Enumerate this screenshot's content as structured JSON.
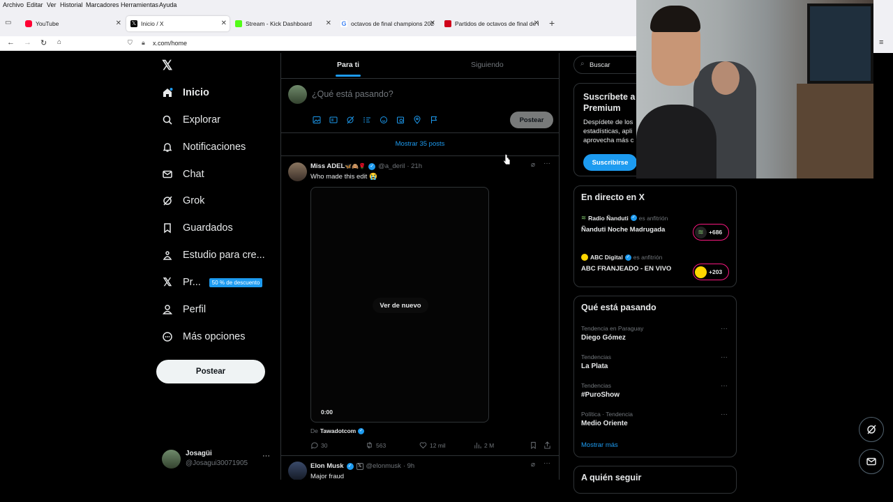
{
  "browser": {
    "menu": [
      "Archivo",
      "Editar",
      "Ver",
      "Historial",
      "Marcadores",
      "Herramientas",
      "Ayuda"
    ],
    "tabs": [
      {
        "title": "YouTube",
        "color": "#ff0033"
      },
      {
        "title": "Inicio / X",
        "color": "#000000"
      },
      {
        "title": "Stream - Kick Dashboard",
        "color": "#53fc18"
      },
      {
        "title": "octavos de final champions 202",
        "color": "#4285f4"
      },
      {
        "title": "Partidos de octavos de final de l",
        "color": "#d0021b"
      }
    ],
    "new_tab": "+",
    "url": "x.com/home"
  },
  "sidebar": {
    "items": [
      {
        "label": "Inicio",
        "icon": "home-icon"
      },
      {
        "label": "Explorar",
        "icon": "search-icon"
      },
      {
        "label": "Notificaciones",
        "icon": "bell-icon"
      },
      {
        "label": "Chat",
        "icon": "mail-icon"
      },
      {
        "label": "Grok",
        "icon": "grok-icon"
      },
      {
        "label": "Guardados",
        "icon": "bookmark-icon"
      },
      {
        "label": "Estudio para cre...",
        "icon": "creator-studio-icon"
      },
      {
        "label": "Pr...",
        "icon": "x-premium-icon",
        "badge": "50 % de descuento"
      },
      {
        "label": "Perfil",
        "icon": "person-icon"
      },
      {
        "label": "Más opciones",
        "icon": "more-icon"
      }
    ],
    "post_button": "Postear",
    "account": {
      "name": "Josagüi",
      "handle": "@Josagui30071905",
      "more": "···"
    }
  },
  "feed": {
    "tabs": [
      "Para ti",
      "Siguiendo"
    ],
    "compose_placeholder": "¿Qué está pasando?",
    "compose_post": "Postear",
    "show_more": "Mostrar 35 posts",
    "tweets": [
      {
        "name": "Miss ADEL",
        "name_emoji": "🦋🙈🌹",
        "handle": "@a_deril",
        "time": "· 21h",
        "text": "Who made this edit 😭",
        "video_replay": "Ver de nuevo",
        "video_time": "0:00",
        "source_prefix": "De",
        "source": "Tawadotcom",
        "replies": "30",
        "reposts": "563",
        "likes": "12 mil",
        "views": "2 M"
      },
      {
        "name": "Elon Musk",
        "handle": "@elonmusk",
        "time": "· 9h",
        "text": "Major fraud"
      }
    ]
  },
  "right": {
    "search_placeholder": "Buscar",
    "premium": {
      "title_line1": "Suscríbete a",
      "title_line2": "Premium",
      "body_line1": "Despídete de los",
      "body_line2": "estadísticas, apli",
      "body_line3": "aprovecha más c",
      "button": "Suscribirse"
    },
    "live": {
      "title": "En directo en X",
      "items": [
        {
          "host": "Radio Ñanduti",
          "role": "es anfitrión",
          "title": "Ñanduti Noche Madrugada",
          "count": "+686"
        },
        {
          "host": "ABC Digital",
          "role": "es anfitrión",
          "title": "ABC FRANJEADO - EN VIVO",
          "count": "+203"
        }
      ]
    },
    "trends": {
      "title": "Qué está pasando",
      "items": [
        {
          "category": "Tendencia en Paraguay",
          "name": "Diego Gómez"
        },
        {
          "category": "Tendencias",
          "name": "La Plata"
        },
        {
          "category": "Tendencias",
          "name": "#PuroShow"
        },
        {
          "category": "Política · Tendencia",
          "name": "Medio Oriente"
        }
      ],
      "show_more": "Mostrar más"
    },
    "who_to_follow": "A quién seguir"
  }
}
